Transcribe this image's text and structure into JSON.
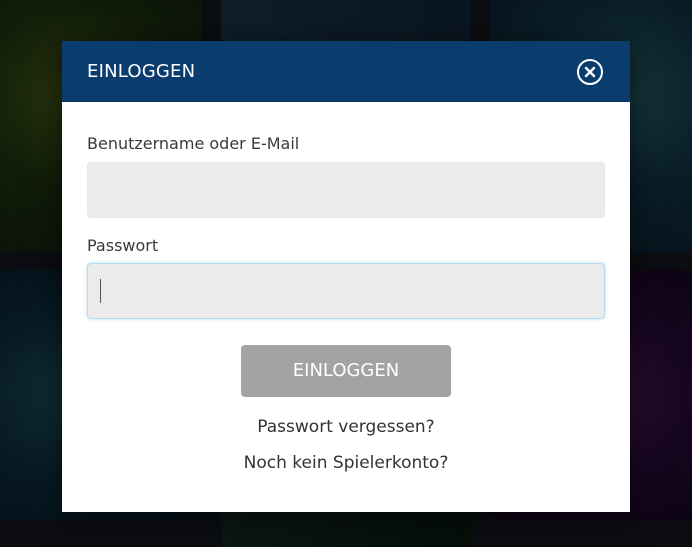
{
  "modal": {
    "title": "EINLOGGEN",
    "close_icon": "close-circle-icon"
  },
  "form": {
    "username_label": "Benutzername oder E-Mail",
    "username_value": "",
    "password_label": "Passwort",
    "password_value": "",
    "submit_label": "EINLOGGEN"
  },
  "links": {
    "forgot_password": "Passwort vergessen?",
    "register": "Noch kein Spielerkonto?"
  },
  "colors": {
    "header_bg": "#0a3d6e",
    "button_disabled_bg": "#a3a3a3",
    "input_bg": "#ebebeb",
    "focus_border": "#b7dcef"
  }
}
